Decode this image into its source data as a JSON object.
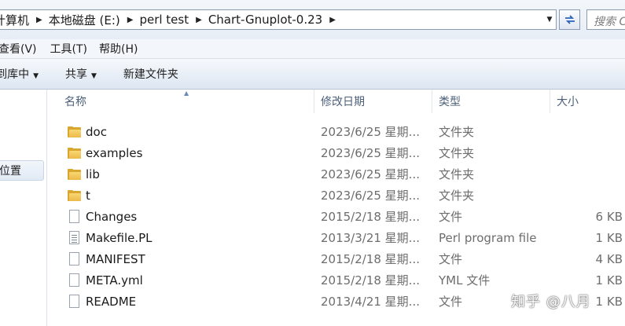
{
  "address": {
    "crumbs": [
      "计算机",
      "本地磁盘 (E:)",
      "perl test",
      "Chart-Gnuplot-0.23"
    ],
    "search_placeholder": "搜索 C"
  },
  "menu": [
    "查看(V)",
    "工具(T)",
    "帮助(H)"
  ],
  "commands": [
    {
      "label": "包含到库中",
      "dropdown": true
    },
    {
      "label": "共享",
      "dropdown": true
    },
    {
      "label": "新建文件夹",
      "dropdown": false
    }
  ],
  "nav": {
    "selected_item": "位置"
  },
  "columns": {
    "name": "名称",
    "date": "修改日期",
    "type": "类型",
    "size": "大小"
  },
  "files": [
    {
      "icon": "folder-icon",
      "name": "doc",
      "date": "2023/6/25 星期...",
      "type": "文件夹",
      "size": ""
    },
    {
      "icon": "folder-icon",
      "name": "examples",
      "date": "2023/6/25 星期...",
      "type": "文件夹",
      "size": ""
    },
    {
      "icon": "folder-icon",
      "name": "lib",
      "date": "2023/6/25 星期...",
      "type": "文件夹",
      "size": ""
    },
    {
      "icon": "folder-icon",
      "name": "t",
      "date": "2023/6/25 星期...",
      "type": "文件夹",
      "size": ""
    },
    {
      "icon": "file-icon",
      "name": "Changes",
      "date": "2015/2/18 星期...",
      "type": "文件",
      "size": "6 KB"
    },
    {
      "icon": "perl-file-icon",
      "name": "Makefile.PL",
      "date": "2013/3/21 星期...",
      "type": "Perl program file",
      "size": "1 KB"
    },
    {
      "icon": "file-icon",
      "name": "MANIFEST",
      "date": "2015/2/18 星期...",
      "type": "文件",
      "size": "4 KB"
    },
    {
      "icon": "file-icon",
      "name": "META.yml",
      "date": "2015/2/18 星期...",
      "type": "YML 文件",
      "size": "1 KB"
    },
    {
      "icon": "file-icon",
      "name": "README",
      "date": "2013/4/21 星期...",
      "type": "文件",
      "size": "1 KB"
    }
  ],
  "watermark": "知乎 @八月"
}
